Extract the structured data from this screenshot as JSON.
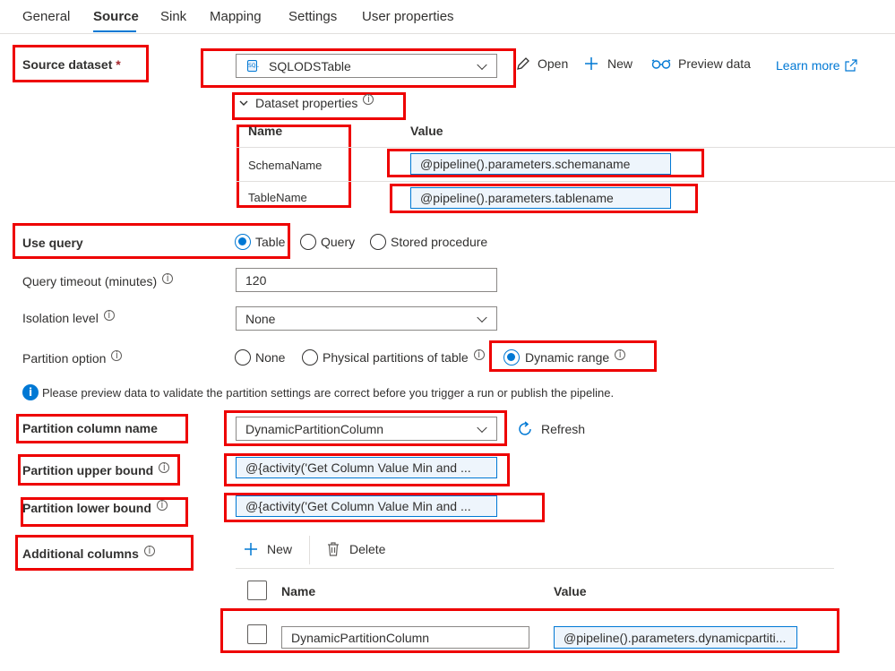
{
  "tabs": [
    {
      "label": "General"
    },
    {
      "label": "Source"
    },
    {
      "label": "Sink"
    },
    {
      "label": "Mapping"
    },
    {
      "label": "Settings"
    },
    {
      "label": "User properties"
    }
  ],
  "source_dataset": {
    "label": "Source dataset",
    "required_mark": "*",
    "value": "SQLODSTable",
    "dataset_icon": "sql-database-icon",
    "actions": {
      "open": "Open",
      "new": "New",
      "preview": "Preview data",
      "learn_more": "Learn more"
    }
  },
  "dataset_properties": {
    "title": "Dataset properties",
    "col_name": "Name",
    "col_value": "Value",
    "rows": [
      {
        "name": "SchemaName",
        "value": "@pipeline().parameters.schemaname"
      },
      {
        "name": "TableName",
        "value": "@pipeline().parameters.tablename"
      }
    ]
  },
  "use_query": {
    "label": "Use query",
    "options": [
      "Table",
      "Query",
      "Stored procedure"
    ],
    "selected": "Table"
  },
  "query_timeout": {
    "label": "Query timeout (minutes)",
    "value": "120"
  },
  "isolation_level": {
    "label": "Isolation level",
    "value": "None"
  },
  "partition_option": {
    "label": "Partition option",
    "options": [
      "None",
      "Physical partitions of table",
      "Dynamic range"
    ],
    "selected": "Dynamic range"
  },
  "info_message": "Please preview data to validate the partition settings are correct before you trigger a run or publish the pipeline.",
  "partition_column": {
    "label": "Partition column name",
    "value": "DynamicPartitionColumn",
    "refresh": "Refresh"
  },
  "partition_upper": {
    "label": "Partition upper bound",
    "value": "@{activity('Get Column Value Min and ..."
  },
  "partition_lower": {
    "label": "Partition lower bound",
    "value": "@{activity('Get Column Value Min and ..."
  },
  "additional_columns": {
    "label": "Additional columns",
    "new": "New",
    "delete": "Delete",
    "col_name": "Name",
    "col_value": "Value",
    "rows": [
      {
        "name": "DynamicPartitionColumn",
        "value": "@pipeline().parameters.dynamicpartiti..."
      }
    ]
  },
  "colors": {
    "accent": "#0078d4",
    "highlight_box": "#ee0000"
  }
}
